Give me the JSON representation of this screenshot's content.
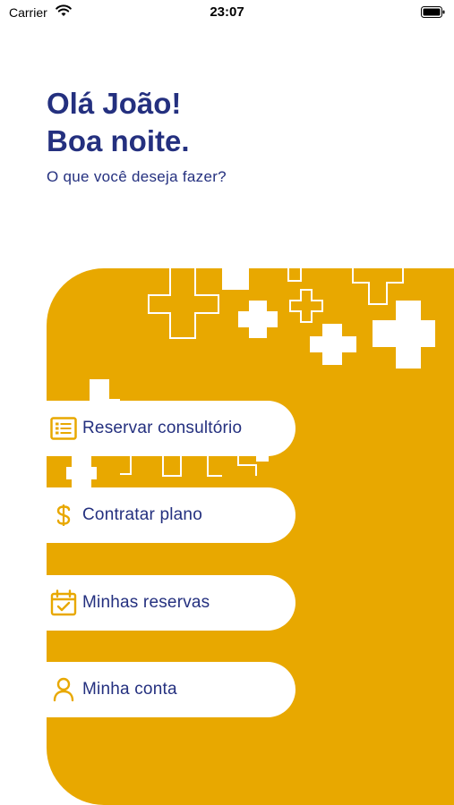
{
  "status_bar": {
    "carrier": "Carrier",
    "time": "23:07"
  },
  "header": {
    "greeting_line1": "Olá João!",
    "greeting_line2": "Boa noite.",
    "question": "O que você deseja fazer?"
  },
  "menu": {
    "items": [
      {
        "label": "Reservar consultório",
        "icon": "list-icon"
      },
      {
        "label": "Contratar plano",
        "icon": "dollar-icon"
      },
      {
        "label": "Minhas reservas",
        "icon": "calendar-check-icon"
      },
      {
        "label": "Minha conta",
        "icon": "user-icon"
      }
    ]
  },
  "colors": {
    "primary": "#24307f",
    "accent": "#e8a800",
    "background": "#ffffff"
  }
}
